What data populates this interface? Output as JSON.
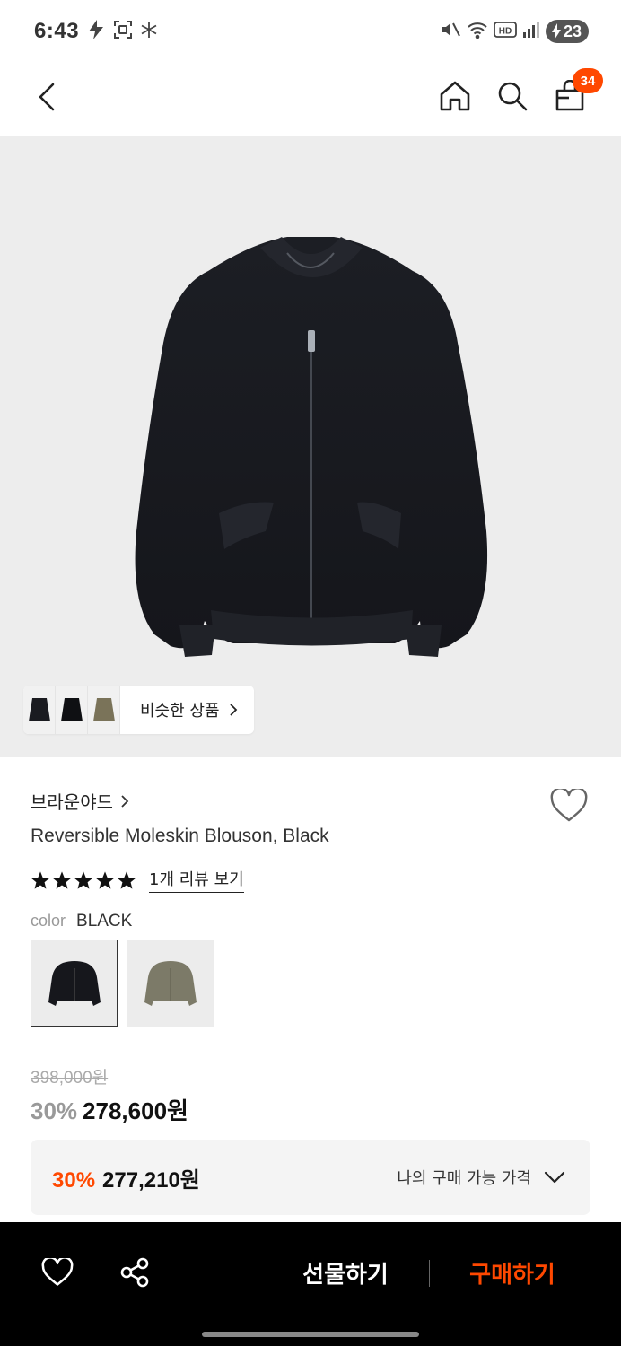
{
  "status": {
    "time": "6:43",
    "battery": "23"
  },
  "nav": {
    "cart_count": "34"
  },
  "similar": {
    "label": "비슷한 상품"
  },
  "product": {
    "brand": "브라운야드",
    "name": "Reversible Moleskin Blouson, Black",
    "stars": 5,
    "review_link": "1개 리뷰 보기",
    "color_key": "color",
    "color_value": "BLACK",
    "swatches": [
      "black",
      "olive"
    ],
    "original_price": "398,000원",
    "sale_rate": "30%",
    "sale_price": "278,600원"
  },
  "my_price": {
    "rate": "30%",
    "price": "277,210원",
    "label": "나의 구매 가능 가격"
  },
  "bottom": {
    "gift_label": "선물하기",
    "buy_label": "구매하기"
  },
  "colors": {
    "accent": "#ff4800",
    "bottom_bar": "#000000",
    "image_bg": "#ededed"
  }
}
